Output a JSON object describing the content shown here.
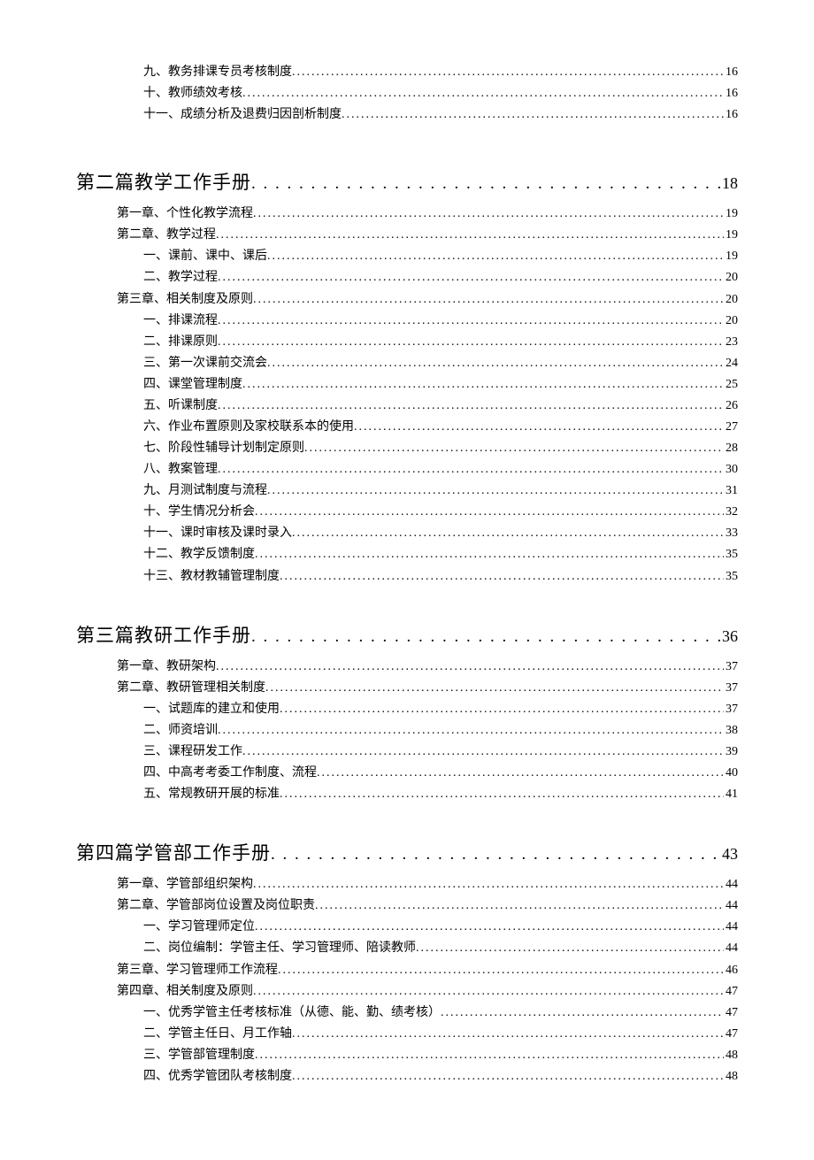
{
  "top_fragment": [
    {
      "title": "九、教务排课专员考核制度",
      "page": "16"
    },
    {
      "title": "十、教师绩效考核",
      "page": "16"
    },
    {
      "title": "十一、成绩分析及退费归因剖析制度",
      "page": "16"
    }
  ],
  "parts": [
    {
      "heading": "第二篇教学工作手册",
      "page": "18",
      "entries": [
        {
          "lvl": 2,
          "title": "第一章、个性化教学流程",
          "page": "19"
        },
        {
          "lvl": 2,
          "title": "第二章、教学过程",
          "page": "19"
        },
        {
          "lvl": 3,
          "title": "一、课前、课中、课后",
          "page": "19"
        },
        {
          "lvl": 3,
          "title": "二、教学过程",
          "page": "20"
        },
        {
          "lvl": 2,
          "title": "第三章、相关制度及原则",
          "page": "20"
        },
        {
          "lvl": 3,
          "title": "一、排课流程",
          "page": "20"
        },
        {
          "lvl": 3,
          "title": "二、排课原则",
          "page": "23"
        },
        {
          "lvl": 3,
          "title": "三、第一次课前交流会",
          "page": "24"
        },
        {
          "lvl": 3,
          "title": "四、课堂管理制度",
          "page": "25"
        },
        {
          "lvl": 3,
          "title": "五、听课制度",
          "page": "26"
        },
        {
          "lvl": 3,
          "title": "六、作业布置原则及家校联系本的使用",
          "page": "27"
        },
        {
          "lvl": 3,
          "title": "七、阶段性辅导计划制定原则",
          "page": "28"
        },
        {
          "lvl": 3,
          "title": "八、教案管理",
          "page": "30"
        },
        {
          "lvl": 3,
          "title": "九、月测试制度与流程",
          "page": "31"
        },
        {
          "lvl": 3,
          "title": "十、学生情况分析会",
          "page": "32"
        },
        {
          "lvl": 3,
          "title": "十一、课时审核及课时录入",
          "page": "33"
        },
        {
          "lvl": 3,
          "title": "十二、教学反馈制度",
          "page": "35"
        },
        {
          "lvl": 3,
          "title": "十三、教材教辅管理制度",
          "page": "35"
        }
      ]
    },
    {
      "heading": "第三篇教研工作手册",
      "page": "36",
      "entries": [
        {
          "lvl": 2,
          "title": "第一章、教研架构",
          "page": "37"
        },
        {
          "lvl": 2,
          "title": "第二章、教研管理相关制度",
          "page": "37"
        },
        {
          "lvl": 3,
          "title": "一、试题库的建立和使用",
          "page": "37"
        },
        {
          "lvl": 3,
          "title": "二、师资培训",
          "page": "38"
        },
        {
          "lvl": 3,
          "title": "三、课程研发工作",
          "page": "39"
        },
        {
          "lvl": 3,
          "title": "四、中高考考委工作制度、流程",
          "page": "40"
        },
        {
          "lvl": 3,
          "title": "五、常规教研开展的标准",
          "page": "41"
        }
      ]
    },
    {
      "heading": "第四篇学管部工作手册",
      "page": "43",
      "entries": [
        {
          "lvl": 2,
          "title": "第一章、学管部组织架构",
          "page": "44"
        },
        {
          "lvl": 2,
          "title": "第二章、学管部岗位设置及岗位职责",
          "page": "44"
        },
        {
          "lvl": 3,
          "title": "一、学习管理师定位",
          "page": "44"
        },
        {
          "lvl": 3,
          "title": "二、岗位编制：学管主任、学习管理师、陪读教师",
          "page": "44"
        },
        {
          "lvl": 2,
          "title": "第三章、学习管理师工作流程",
          "page": "46"
        },
        {
          "lvl": 2,
          "title": "第四章、相关制度及原则",
          "page": "47"
        },
        {
          "lvl": 3,
          "title": "一、优秀学管主任考核标准（从德、能、勤、绩考核）",
          "page": "47"
        },
        {
          "lvl": 3,
          "title": "二、学管主任日、月工作轴",
          "page": "47"
        },
        {
          "lvl": 3,
          "title": "三、学管部管理制度",
          "page": "48"
        },
        {
          "lvl": 3,
          "title": "四、优秀学管团队考核制度",
          "page": "48"
        }
      ]
    }
  ],
  "dots_small": "........................................................................................................................................................................................",
  "dots_large": ". . . . . . . . . . . . . . . . . . . . . . . . . . . . . . . . . . . . . . . . . . . . . . . . . . . . . . . . . . . . . . . . . . . . . . . . . .",
  "dots_large_alt": ". . . . . . . . . . . . . . . . . . . . . . . . . . . . . . . . . . . . . . . . . . . . . . . . . . . . . . . . . . . . . . . . . . . . . . . ."
}
